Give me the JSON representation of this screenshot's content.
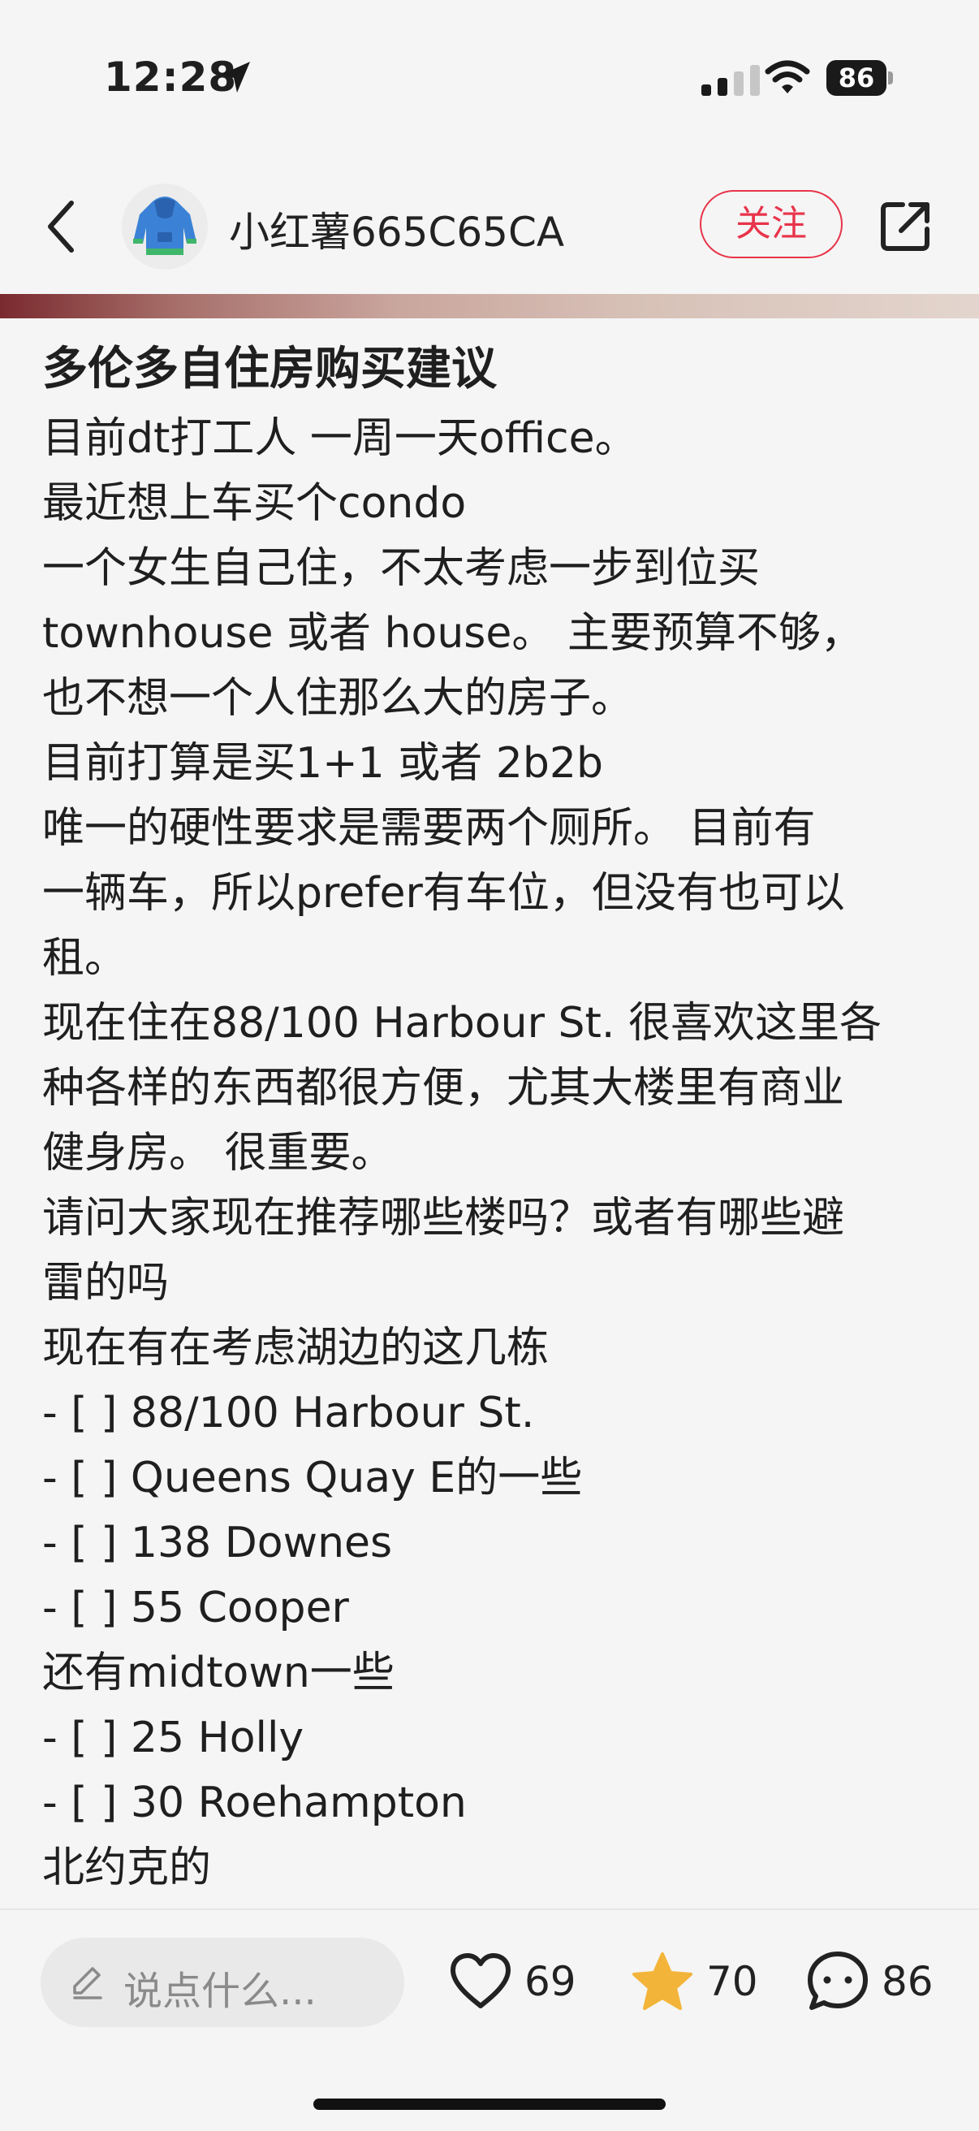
{
  "status_bar": {
    "time": "12:28",
    "battery": "86"
  },
  "header": {
    "username": "小红薯665C65CA",
    "follow_label": "关注"
  },
  "post": {
    "title": "多伦多自住房购买建议",
    "lines": [
      "目前dt打工人 一周一天office。",
      "最近想上车买个condo",
      "一个女生自己住，不太考虑一步到位买",
      " townhouse 或者 house。 主要预算不够，",
      "也不想一个人住那么大的房子。",
      "目前打算是买1+1 或者 2b2b",
      "唯一的硬性要求是需要两个厕所。 目前有",
      "一辆车，所以prefer有车位，但没有也可以",
      "租。",
      "现在住在88/100 Harbour St. 很喜欢这里各",
      "种各样的东西都很方便，尤其大楼里有商业",
      "健身房。 很重要。",
      "请问大家现在推荐哪些楼吗？或者有哪些避",
      "雷的吗",
      "现在有在考虑湖边的这几栋",
      "- [ ] 88/100 Harbour St.",
      "- [ ] Queens Quay E的一些",
      "- [ ] 138 Downes",
      "- [ ] 55 Cooper",
      "还有midtown一些",
      "- [ ] 25 Holly",
      "- [ ] 30 Roehampton",
      "北约克的"
    ]
  },
  "bottom_bar": {
    "comment_placeholder": "说点什么...",
    "likes": "69",
    "favorites": "70",
    "comments": "86"
  },
  "colors": {
    "accent": "#e8344a",
    "star": "#f3b43a",
    "background": "#f5f5f5"
  },
  "icons": [
    "location-arrow-icon",
    "signal-icon",
    "wifi-icon",
    "battery-icon",
    "back-icon",
    "hoodie-avatar",
    "share-icon",
    "pencil-icon",
    "heart-icon",
    "star-icon",
    "comment-icon"
  ]
}
